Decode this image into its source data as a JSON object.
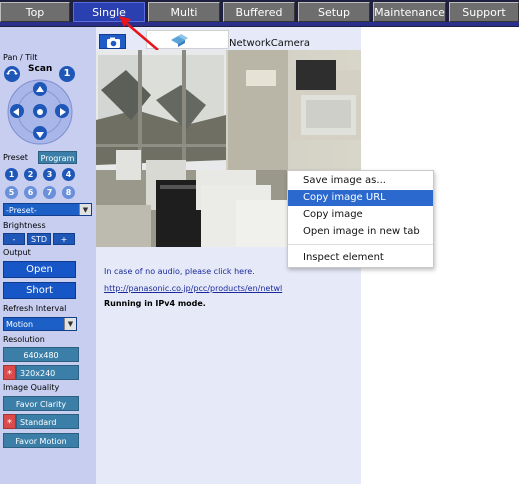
{
  "nav": {
    "tabs": [
      {
        "label": "Top"
      },
      {
        "label": "Single"
      },
      {
        "label": "Multi"
      },
      {
        "label": "Buffered Image"
      },
      {
        "label": "Setup"
      },
      {
        "label": "Maintenance"
      },
      {
        "label": "Support"
      }
    ],
    "active": "Single"
  },
  "sidebar": {
    "pan_tilt_label": "Pan / Tilt",
    "scan_label": "Scan",
    "scan_number": "1",
    "preset_label": "Preset",
    "program_button": "Program",
    "preset_numbers": [
      "1",
      "2",
      "3",
      "4",
      "5",
      "6",
      "7",
      "8"
    ],
    "preset_select": "-Preset-",
    "brightness_label": "Brightness",
    "brightness_minus": "-",
    "brightness_std": "STD",
    "brightness_plus": "+",
    "output_label": "Output",
    "open_button": "Open",
    "short_button": "Short",
    "refresh_label": "Refresh Interval",
    "refresh_select": "Motion",
    "resolution_label": "Resolution",
    "res_640": "640x480",
    "res_320": "320x240",
    "quality_label": "Image Quality",
    "favor_clarity": "Favor Clarity",
    "standard": "Standard",
    "favor_motion": "Favor Motion",
    "selected_marker": "*"
  },
  "main": {
    "camera_name": "NetworkCamera",
    "audio_note": "In case of no audio, please click here.",
    "url": "http://panasonic.co.jp/pcc/products/en/netwl",
    "status": "Running in IPv4 mode."
  },
  "context_menu": {
    "items": [
      {
        "label": "Save image as..."
      },
      {
        "label": "Copy image URL"
      },
      {
        "label": "Copy image"
      },
      {
        "label": "Open image in new tab"
      },
      {
        "label": "Inspect element"
      }
    ],
    "highlighted": "Copy image URL"
  },
  "colors": {
    "nav_bg": "#1f1f3f",
    "tab_active": "#2a3fb0",
    "sidebar_bg": "#c7cef0",
    "menu_highlight": "#2c69cf",
    "annotation_arrow": "#e8141b"
  },
  "icons": [
    "camera-icon",
    "ptz-up-arrow-icon",
    "ptz-down-arrow-icon",
    "ptz-left-arrow-icon",
    "ptz-right-arrow-icon",
    "ptz-home-icon",
    "pan-tilt-rotate-icon",
    "multi-screen-icon",
    "dropdown-arrow-icon",
    "red-annotation-arrow-icon"
  ]
}
